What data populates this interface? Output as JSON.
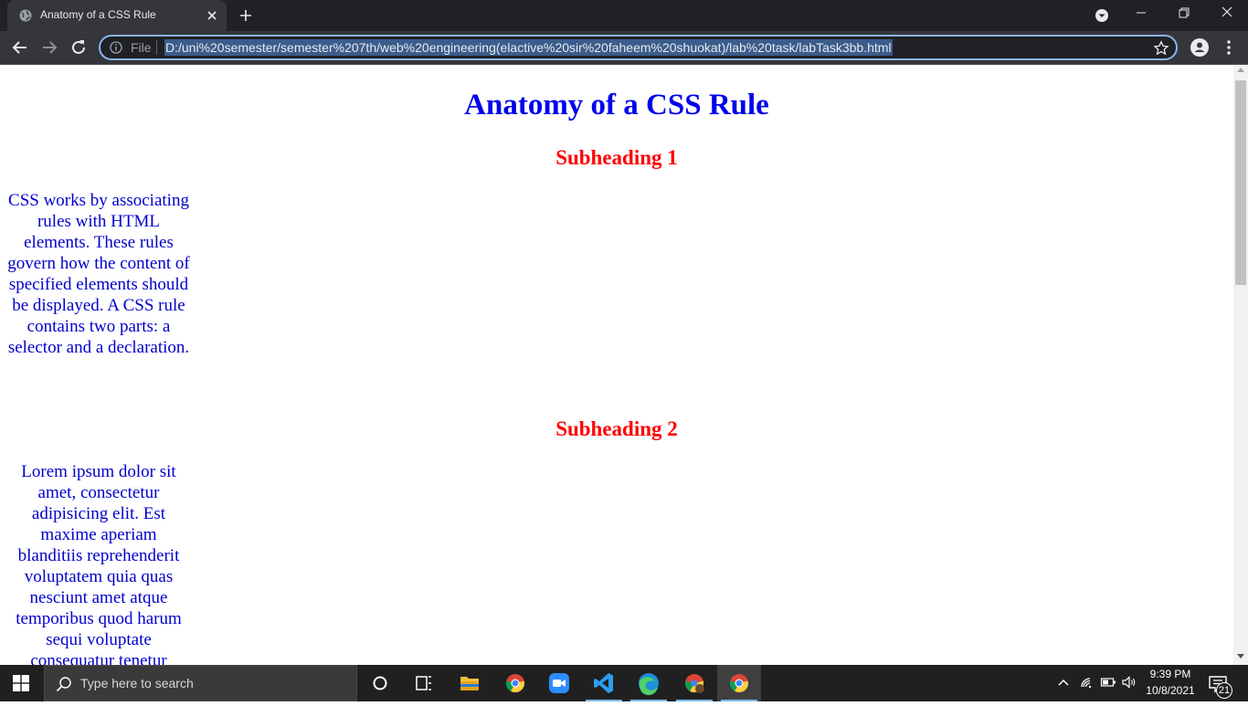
{
  "browser": {
    "tab_title": "Anatomy of a CSS Rule",
    "url_scheme": "File",
    "url": "D:/uni%20semester/semester%207th/web%20engineering(elactive%20sir%20faheem%20shuokat)/lab%20task/labTask3bb.html"
  },
  "page": {
    "title": "Anatomy of a CSS Rule",
    "subheading1": "Subheading 1",
    "paragraph1": "CSS works by associating rules with HTML elements. These rules govern how the content of specified elements should be displayed. A CSS rule contains two parts: a selector and a declaration.",
    "subheading2": "Subheading 2",
    "paragraph2": "Lorem ipsum dolor sit amet, consectetur adipisicing elit. Est maxime aperiam blanditiis reprehenderit voluptatem quia quas nesciunt amet atque temporibus quod harum sequi voluptate consequatur tenetur"
  },
  "taskbar": {
    "search_placeholder": "Type here to search",
    "time": "9:39 PM",
    "date": "10/8/2021",
    "notification_count": "21"
  },
  "colors": {
    "heading": "#0000ee",
    "subheading": "#ff0000",
    "paragraph": "#0000cc"
  }
}
